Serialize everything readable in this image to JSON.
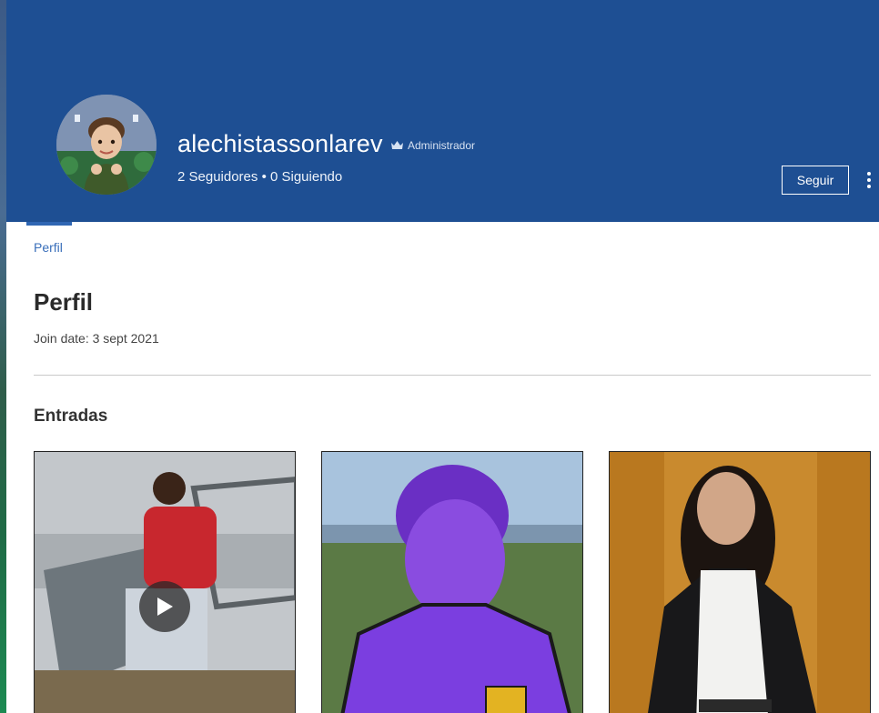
{
  "profile": {
    "username": "alechistassonlarev",
    "role": "Administrador",
    "follow_stats": "2 Seguidores • 0 Siguiendo",
    "follow_button": "Seguir"
  },
  "tabs": [
    {
      "label": "Perfil",
      "active": true
    }
  ],
  "about": {
    "title": "Perfil",
    "join_date": "Join date: 3 sept 2021"
  },
  "posts": {
    "title": "Entradas",
    "items": [
      {
        "type": "video",
        "icon": "play-icon"
      },
      {
        "type": "image"
      },
      {
        "type": "image"
      }
    ]
  },
  "icons": {
    "role": "crown-icon",
    "more": "more-vertical-icon"
  },
  "colors": {
    "header_bg": "#1e4f93",
    "accent": "#3a6fba",
    "text": "#2a2a2a"
  }
}
